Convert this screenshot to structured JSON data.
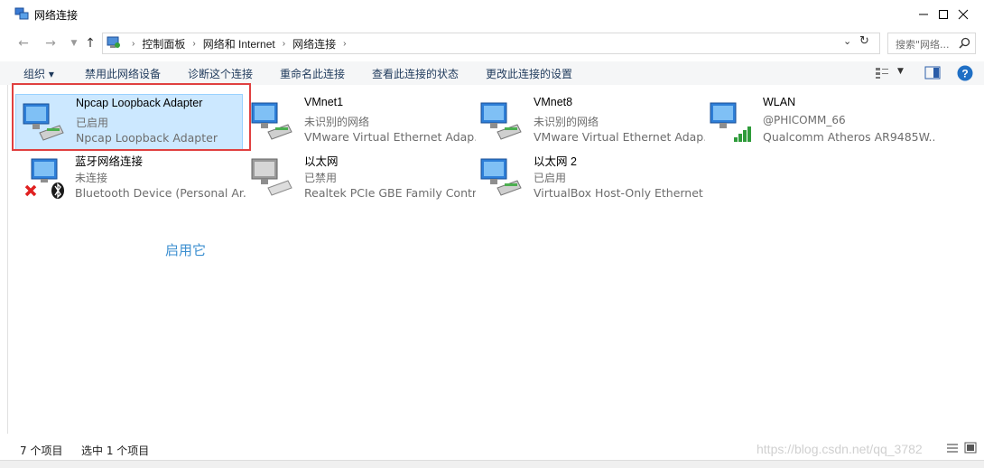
{
  "window": {
    "title": "网络连接"
  },
  "address": {
    "crumbs": [
      "控制面板",
      "网络和 Internet",
      "网络连接"
    ],
    "search_placeholder": "搜索\"网络..."
  },
  "toolbar": {
    "organize": "组织 ▾",
    "disable": "禁用此网络设备",
    "diagnose": "诊断这个连接",
    "rename": "重命名此连接",
    "view_status": "查看此连接的状态",
    "change_settings": "更改此连接的设置"
  },
  "items": [
    {
      "name": "Npcap Loopback Adapter",
      "status": "已启用",
      "device": "Npcap Loopback Adapter",
      "icon": "ethernet-adapter-icon"
    },
    {
      "name": "VMnet1",
      "status": "未识别的网络",
      "device": "VMware Virtual Ethernet Adap...",
      "icon": "ethernet-adapter-icon"
    },
    {
      "name": "VMnet8",
      "status": "未识别的网络",
      "device": "VMware Virtual Ethernet Adap...",
      "icon": "ethernet-adapter-icon"
    },
    {
      "name": "WLAN",
      "status": "@PHICOMM_66",
      "device": "Qualcomm Atheros AR9485W...",
      "icon": "wlan-adapter-icon"
    },
    {
      "name": "蓝牙网络连接",
      "status": "未连接",
      "device": "Bluetooth Device (Personal Ar...",
      "icon": "bluetooth-adapter-icon"
    },
    {
      "name": "以太网",
      "status": "已禁用",
      "device": "Realtek PCIe GBE Family Contr...",
      "icon": "disabled-adapter-icon"
    },
    {
      "name": "以太网 2",
      "status": "已启用",
      "device": "VirtualBox Host-Only Ethernet ...",
      "icon": "ethernet-adapter-icon"
    }
  ],
  "annotation": "启用它",
  "statusbar": {
    "count": "7 个项目",
    "selected": "选中 1 个项目"
  },
  "watermark": "https://blog.csdn.net/qq_3782",
  "colors": {
    "selection": "#cce8ff",
    "highlight_box": "#e04040",
    "annotation": "#3c8fd0"
  }
}
